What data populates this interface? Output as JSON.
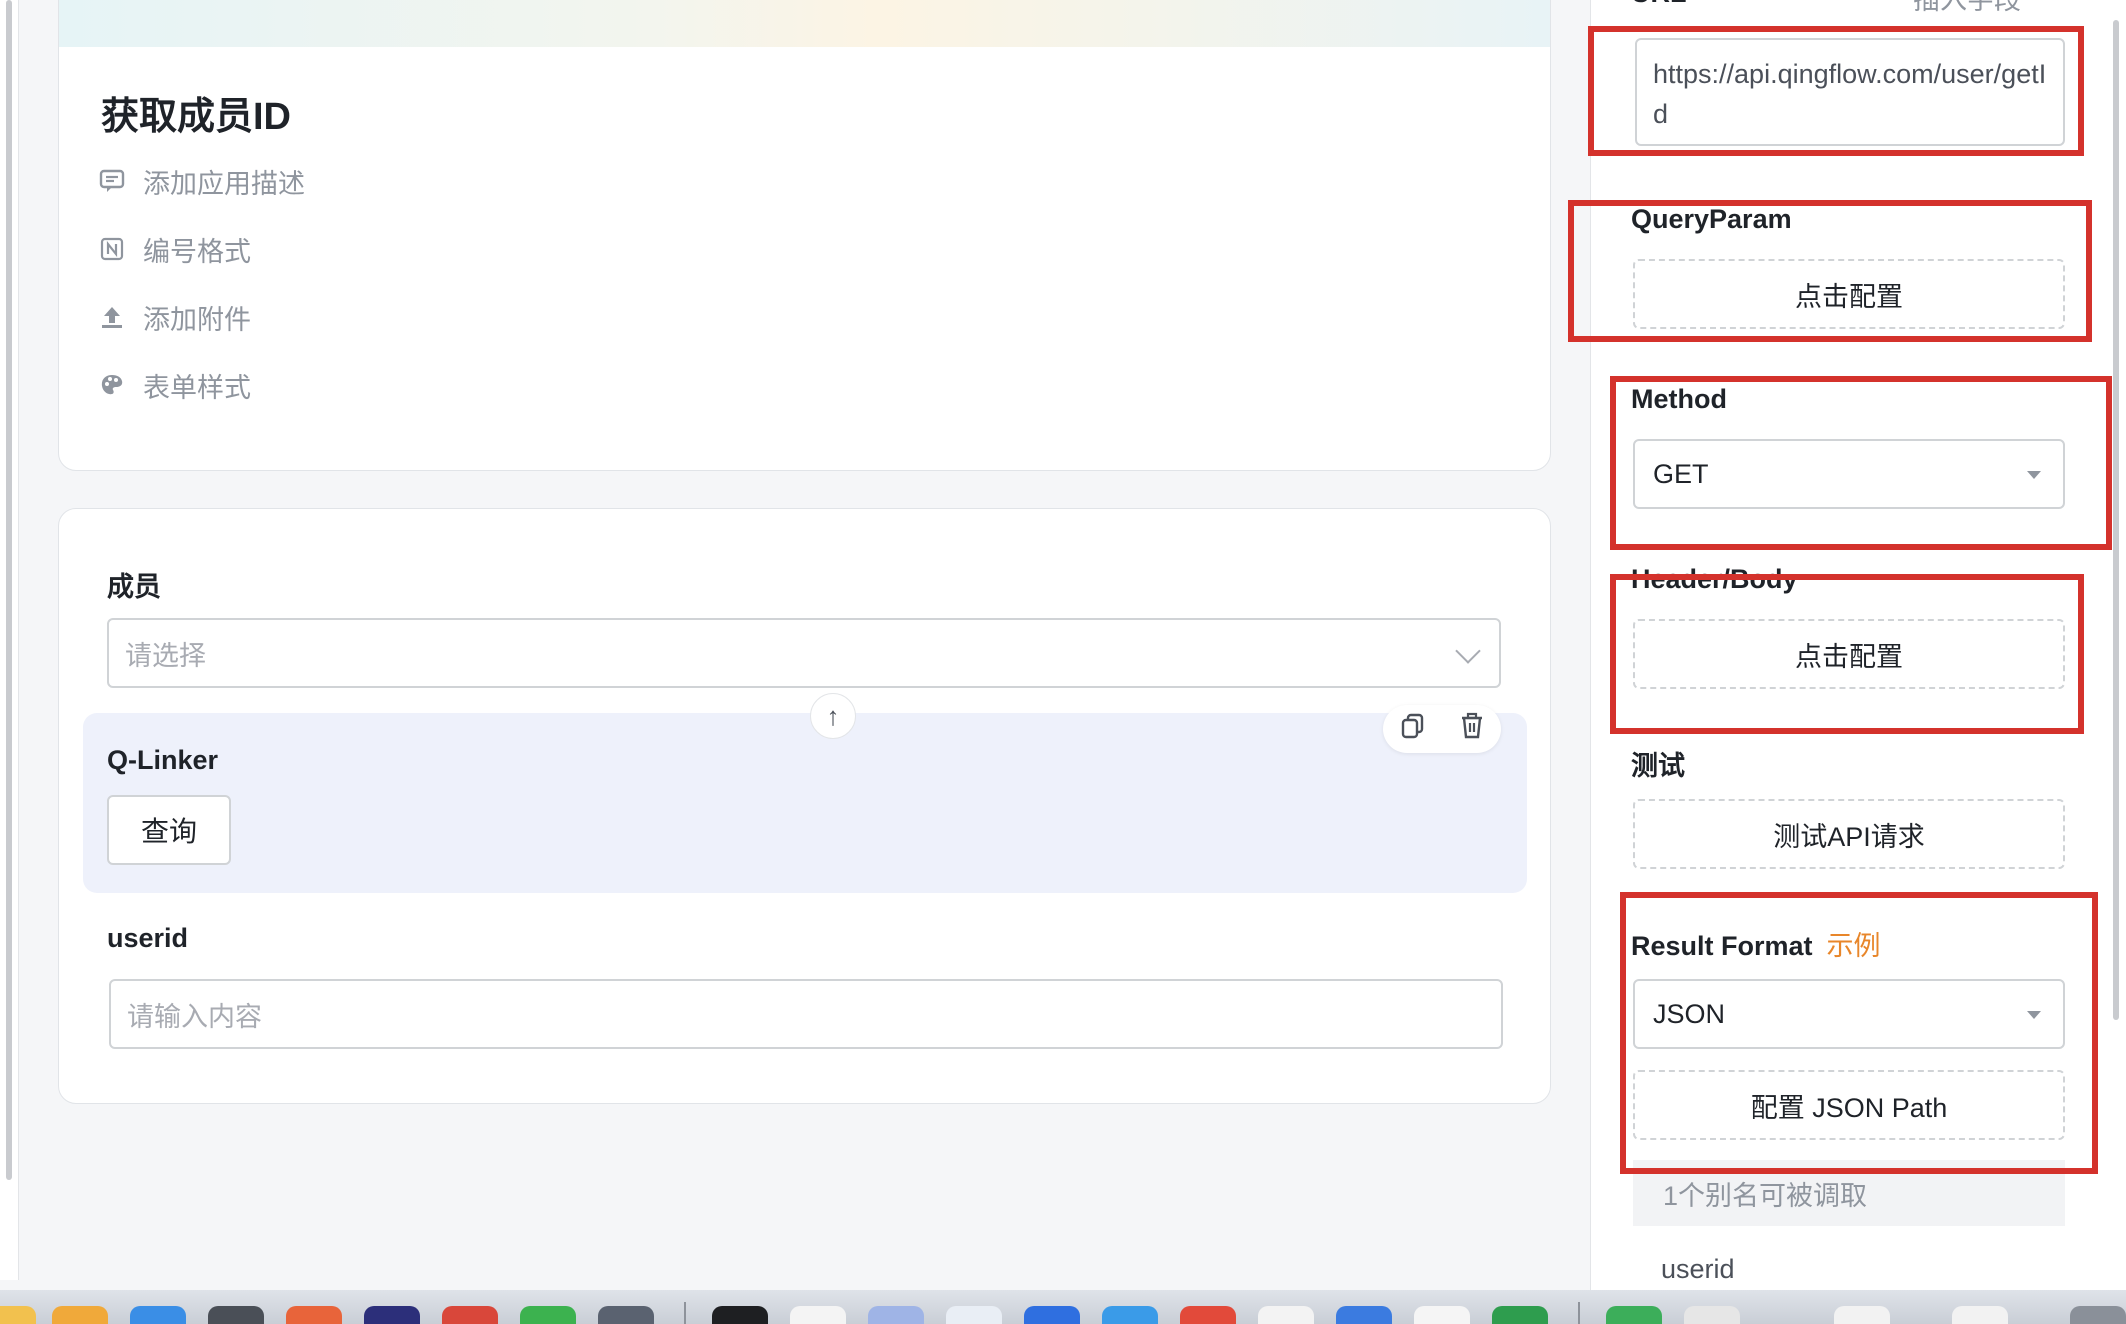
{
  "form": {
    "title": "获取成员ID",
    "options": [
      {
        "label": "添加应用描述",
        "icon": "comment-icon"
      },
      {
        "label": "编号格式",
        "icon": "numbering-icon"
      },
      {
        "label": "添加附件",
        "icon": "upload-icon"
      },
      {
        "label": "表单样式",
        "icon": "palette-icon"
      }
    ],
    "fields": {
      "member": {
        "label": "成员",
        "placeholder": "请选择"
      },
      "qlinker": {
        "label": "Q-Linker",
        "button": "查询"
      },
      "userid": {
        "label": "userid",
        "placeholder": "请输入内容"
      }
    },
    "move_up_glyph": "↑"
  },
  "panel": {
    "url": {
      "label": "URL",
      "hint": "插入字段",
      "value": "https://api.qingflow.com/user/getId"
    },
    "query_param": {
      "label": "QueryParam",
      "button": "点击配置"
    },
    "method": {
      "label": "Method",
      "value": "GET"
    },
    "header_body": {
      "label": "Header/Body",
      "button": "点击配置"
    },
    "test": {
      "label": "测试",
      "button": "测试API请求"
    },
    "result_format": {
      "label": "Result Format",
      "example": "示例",
      "value": "JSON",
      "json_path_button": "配置 JSON Path"
    },
    "alias": {
      "header": "1个别名可被调取",
      "items": [
        "userid"
      ]
    }
  },
  "colors": {
    "highlight_border": "#d4322c",
    "example_link": "#e8862a",
    "active_field_bg": "#eef1fb"
  }
}
